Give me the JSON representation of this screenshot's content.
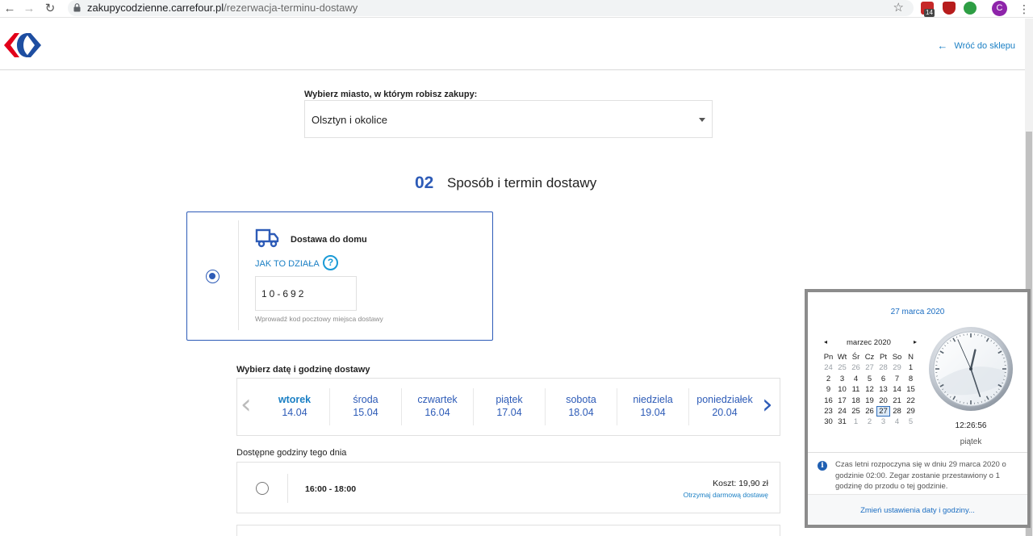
{
  "browser": {
    "url_host": "zakupycodzienne.carrefour.pl",
    "url_path": "/rezerwacja-terminu-dostawy",
    "ext_badge": "14",
    "profile_initial": "C"
  },
  "header": {
    "back_label": "Wróć do sklepu"
  },
  "city": {
    "label": "Wybierz miasto, w którym robisz zakupy:",
    "selected": "Olsztyn i okolice"
  },
  "section": {
    "number": "02",
    "title": "Sposób i termin dostawy"
  },
  "delivery": {
    "title": "Dostawa do domu",
    "how_link": "JAK TO DZIAŁA",
    "help_glyph": "?",
    "postal_code": "10-692",
    "postal_hint": "Wprowadź kod pocztowy miejsca dostawy"
  },
  "dates": {
    "label": "Wybierz datę i godzinę dostawy",
    "days": [
      {
        "name": "wtorek",
        "date": "14.04"
      },
      {
        "name": "środa",
        "date": "15.04"
      },
      {
        "name": "czwartek",
        "date": "16.04"
      },
      {
        "name": "piątek",
        "date": "17.04"
      },
      {
        "name": "sobota",
        "date": "18.04"
      },
      {
        "name": "niedziela",
        "date": "19.04"
      },
      {
        "name": "poniedziałek",
        "date": "20.04"
      }
    ]
  },
  "hours": {
    "label": "Dostępne godziny tego dnia",
    "slots": [
      {
        "time": "16:00 - 18:00",
        "cost": "Koszt: 19,90 zł",
        "free_link": "Otrzymaj darmową dostawę"
      }
    ]
  },
  "clock_flyout": {
    "date_header": "27 marca 2020",
    "month": "marzec 2020",
    "nav_prev": "◂",
    "nav_next": "▸",
    "weekdays": [
      "Pn",
      "Wt",
      "Śr",
      "Cz",
      "Pt",
      "So",
      "N"
    ],
    "weeks": [
      [
        "24",
        "25",
        "26",
        "27",
        "28",
        "29",
        "1"
      ],
      [
        "2",
        "3",
        "4",
        "5",
        "6",
        "7",
        "8"
      ],
      [
        "9",
        "10",
        "11",
        "12",
        "13",
        "14",
        "15"
      ],
      [
        "16",
        "17",
        "18",
        "19",
        "20",
        "21",
        "22"
      ],
      [
        "23",
        "24",
        "25",
        "26",
        "27",
        "28",
        "29"
      ],
      [
        "30",
        "31",
        "1",
        "2",
        "3",
        "4",
        "5"
      ]
    ],
    "today": "27",
    "time": "12:26:56",
    "clock_hour": 12,
    "clock_minute": 26,
    "clock_second": 56,
    "weekday": "piątek",
    "info_text": "Czas letni rozpoczyna się w dniu 29 marca 2020 o godzinie 02:00. Zegar zostanie przestawiony o 1 godzinę do przodu o tej godzinie.",
    "settings_link": "Zmień ustawienia daty i godziny..."
  }
}
